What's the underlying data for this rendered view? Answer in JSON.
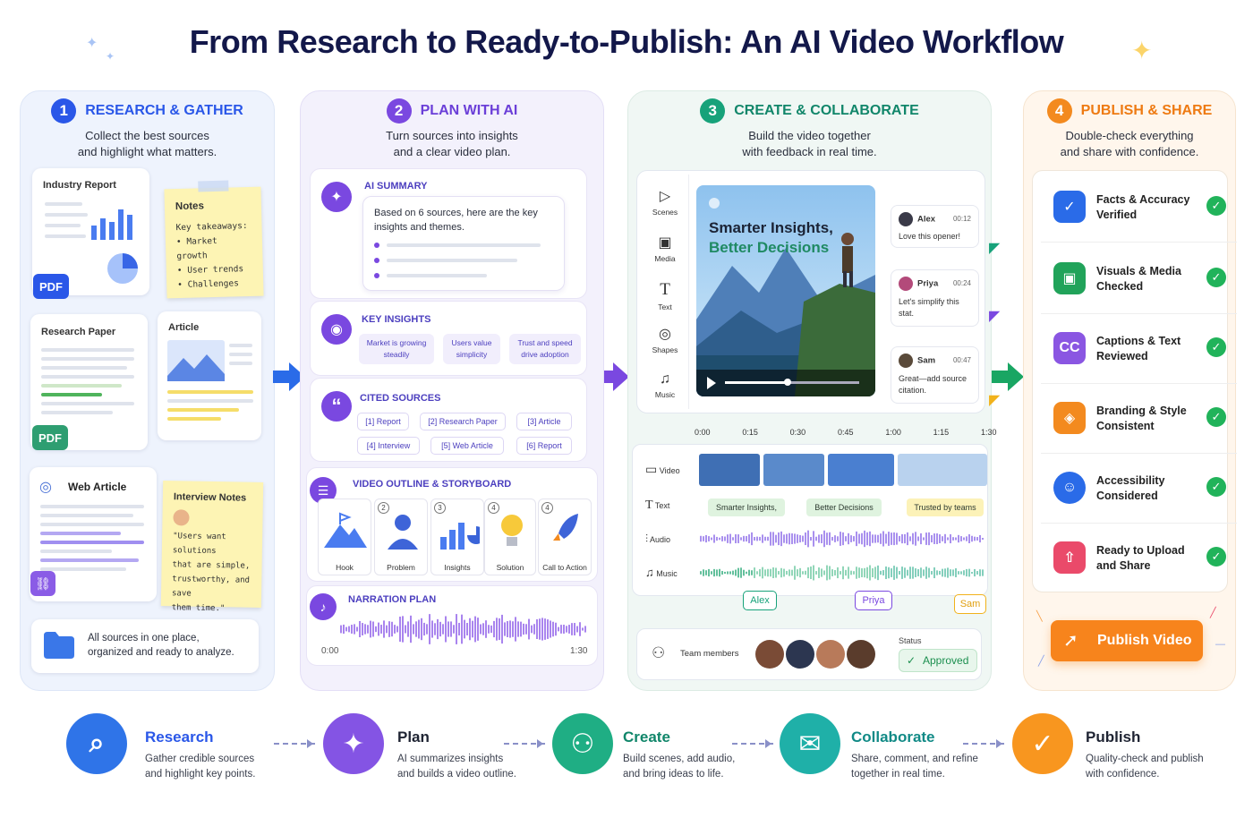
{
  "title": "From Research to Ready-to-Publish: An AI Video Workflow",
  "colors": {
    "research": "#2a57e8",
    "plan": "#7a48e0",
    "create": "#17a27a",
    "publish": "#f38a1f",
    "check": "#21b35a"
  },
  "p1": {
    "num": "1",
    "heading": "RESEARCH & GATHER",
    "sub": "Collect the best sources\nand highlight what matters.",
    "industry_report": "Industry Report",
    "pdf1": "PDF",
    "notes_title": "Notes",
    "notes_body": "Key takeaways:\n• Market growth\n• User trends\n• Challenges",
    "research_paper": "Research Paper",
    "pdf2": "PDF",
    "article": "Article",
    "web_article": "Web Article",
    "interview_title": "Interview Notes",
    "interview_body": "\"Users want solutions\nthat are simple,\ntrustworthy, and save\nthem time.\"",
    "footer": "All sources in one place,\norganized and ready to analyze."
  },
  "p2": {
    "num": "2",
    "heading": "PLAN WITH AI",
    "sub": "Turn sources into insights\nand a clear video plan.",
    "summary_title": "AI SUMMARY",
    "summary_text": "Based on 6 sources, here are the key insights and themes.",
    "insights_title": "KEY INSIGHTS",
    "insights": [
      "Market is growing steadily",
      "Users value simplicity",
      "Trust and speed drive adoption"
    ],
    "sources_title": "CITED SOURCES",
    "sources": [
      "[1] Report",
      "[2] Research Paper",
      "[3] Article",
      "[4] Interview",
      "[5] Web Article",
      "[6] Report"
    ],
    "outline_title": "VIDEO OUTLINE & STORYBOARD",
    "storyboard": [
      {
        "n": "",
        "label": "Hook"
      },
      {
        "n": "2",
        "label": "Problem"
      },
      {
        "n": "3",
        "label": "Insights"
      },
      {
        "n": "4",
        "label": "Solution"
      },
      {
        "n": "4",
        "label": "Call to Action"
      }
    ],
    "narration_title": "NARRATION PLAN",
    "t_start": "0:00",
    "t_end": "1:30"
  },
  "p3": {
    "num": "3",
    "heading": "CREATE & COLLABORATE",
    "sub": "Build the video together\nwith feedback in real time.",
    "tools": [
      "Scenes",
      "Media",
      "Text",
      "Shapes",
      "Music"
    ],
    "video_title_1": "Smarter Insights,",
    "video_title_2": "Better Decisions",
    "comments": [
      {
        "name": "Alex",
        "time": "00:12",
        "text": "Love this opener!"
      },
      {
        "name": "Priya",
        "time": "00:24",
        "text": "Let's simplify this stat."
      },
      {
        "name": "Sam",
        "time": "00:47",
        "text": "Great—add source citation."
      }
    ],
    "ticks": [
      "0:00",
      "0:15",
      "0:30",
      "0:45",
      "1:00",
      "1:15",
      "1:30"
    ],
    "tracks": [
      "Video",
      "Text",
      "Audio",
      "Music"
    ],
    "text_chips": [
      "Smarter Insights,",
      "Better Decisions",
      "Trusted by teams"
    ],
    "cursors": [
      "Alex",
      "Priya",
      "Sam"
    ],
    "team_label": "Team members",
    "status_label": "Status",
    "status_value": "Approved"
  },
  "p4": {
    "num": "4",
    "heading": "PUBLISH & SHARE",
    "sub": "Double-check everything\nand share with confidence.",
    "checks": [
      "Facts & Accuracy\nVerified",
      "Visuals & Media\nChecked",
      "Captions & Text\nReviewed",
      "Branding & Style\nConsistent",
      "Accessibility\nConsidered",
      "Ready to Upload\nand Share"
    ],
    "cc": "CC",
    "button": "Publish Video"
  },
  "bottom": [
    {
      "title": "Research",
      "desc": "Gather credible sources\nand highlight key points."
    },
    {
      "title": "Plan",
      "desc": "AI summarizes insights\nand builds a video outline."
    },
    {
      "title": "Create",
      "desc": "Build scenes, add audio,\nand bring ideas to life."
    },
    {
      "title": "Collaborate",
      "desc": "Share, comment, and refine\ntogether in real time."
    },
    {
      "title": "Publish",
      "desc": "Quality-check and publish\nwith confidence."
    }
  ]
}
